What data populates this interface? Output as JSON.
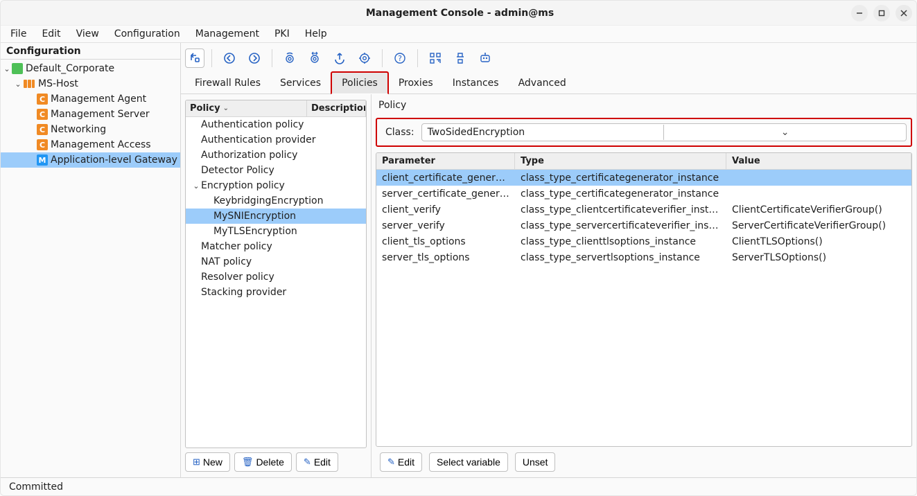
{
  "window": {
    "title": "Management Console - admin@ms"
  },
  "menubar": [
    "File",
    "Edit",
    "View",
    "Configuration",
    "Management",
    "PKI",
    "Help"
  ],
  "sidebar": {
    "title": "Configuration",
    "root": {
      "label": "Default_Corporate"
    },
    "host": {
      "label": "MS-Host"
    },
    "components": [
      {
        "label": "Management Agent"
      },
      {
        "label": "Management Server"
      },
      {
        "label": "Networking"
      },
      {
        "label": "Management Access"
      },
      {
        "label": "Application-level Gateway"
      }
    ]
  },
  "tabs": [
    "Firewall Rules",
    "Services",
    "Policies",
    "Proxies",
    "Instances",
    "Advanced"
  ],
  "policyList": {
    "headers": {
      "policy": "Policy",
      "description": "Description"
    },
    "items": [
      {
        "label": "Authentication policy",
        "depth": 0,
        "children": false
      },
      {
        "label": "Authentication provider",
        "depth": 0,
        "children": false
      },
      {
        "label": "Authorization policy",
        "depth": 0,
        "children": false
      },
      {
        "label": "Detector Policy",
        "depth": 0,
        "children": false
      },
      {
        "label": "Encryption policy",
        "depth": 0,
        "children": true,
        "expanded": true
      },
      {
        "label": "KeybridgingEncryption",
        "depth": 1,
        "children": false
      },
      {
        "label": "MySNIEncryption",
        "depth": 1,
        "children": false,
        "selected": true
      },
      {
        "label": "MyTLSEncryption",
        "depth": 1,
        "children": false
      },
      {
        "label": "Matcher policy",
        "depth": 0,
        "children": false
      },
      {
        "label": "NAT policy",
        "depth": 0,
        "children": false
      },
      {
        "label": "Resolver policy",
        "depth": 0,
        "children": false
      },
      {
        "label": "Stacking provider",
        "depth": 0,
        "children": false
      }
    ],
    "buttons": {
      "new": "New",
      "delete": "Delete",
      "edit": "Edit"
    }
  },
  "detail": {
    "title": "Policy",
    "class_label": "Class:",
    "class_value": "TwoSidedEncryption",
    "headers": {
      "parameter": "Parameter",
      "type": "Type",
      "value": "Value"
    },
    "rows": [
      {
        "parameter": "client_certificate_generator",
        "type": "class_type_certificategenerator_instance",
        "value": "",
        "selected": true
      },
      {
        "parameter": "server_certificate_generator",
        "type": "class_type_certificategenerator_instance",
        "value": ""
      },
      {
        "parameter": "client_verify",
        "type": "class_type_clientcertificateverifier_instance",
        "value": "ClientCertificateVerifierGroup()"
      },
      {
        "parameter": "server_verify",
        "type": "class_type_servercertificateverifier_instance",
        "value": "ServerCertificateVerifierGroup()"
      },
      {
        "parameter": "client_tls_options",
        "type": "class_type_clienttlsoptions_instance",
        "value": "ClientTLSOptions()"
      },
      {
        "parameter": "server_tls_options",
        "type": "class_type_servertlsoptions_instance",
        "value": "ServerTLSOptions()"
      }
    ],
    "buttons": {
      "edit": "Edit",
      "select_var": "Select variable",
      "unset": "Unset"
    }
  },
  "status": "Committed"
}
